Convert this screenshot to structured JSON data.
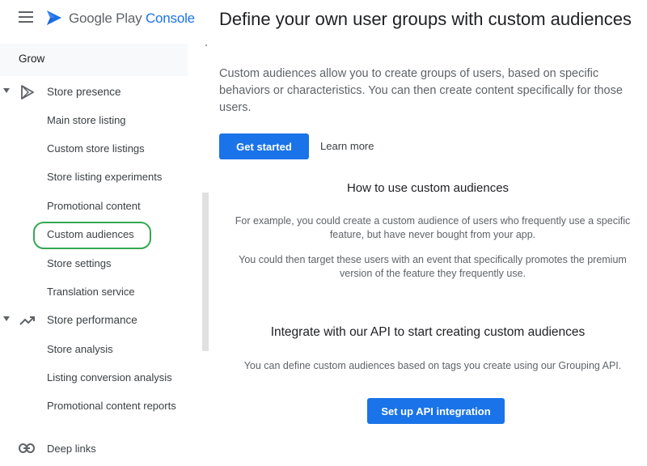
{
  "header": {
    "logo_text_main": "Google Play",
    "logo_text_accent": "Console",
    "brand_color": "#1a73e8"
  },
  "sidebar": {
    "group_label": "Grow",
    "sections": [
      {
        "label": "Store presence",
        "icon": "play-triangle-icon",
        "items": [
          "Main store listing",
          "Custom store listings",
          "Store listing experiments",
          "Promotional content",
          "Custom audiences",
          "Store settings",
          "Translation service"
        ]
      },
      {
        "label": "Store performance",
        "icon": "trending-up-icon",
        "items": [
          "Store analysis",
          "Listing conversion analysis",
          "Promotional content reports"
        ]
      }
    ],
    "deep_links_label": "Deep links",
    "highlighted_item": "Custom audiences",
    "highlight_color": "#34a853"
  },
  "main": {
    "title": "Define your own user groups with custom audiences",
    "intro": "Custom audiences allow you to create groups of users, based on specific behaviors or characteristics. You can then create content specifically for those users.",
    "get_started_label": "Get started",
    "learn_more_label": "Learn more",
    "how_to_title": "How to use custom audiences",
    "how_to_p1": "For example, you could create a custom audience of users who frequently use a specific feature, but have never bought from your app.",
    "how_to_p2": "You could then target these users with an event that specifically promotes the premium version of the feature they frequently use.",
    "integrate_title": "Integrate with our API to start creating custom audiences",
    "integrate_p": "You can define custom audiences based on tags you create using our Grouping API.",
    "api_button_label": "Set up API integration"
  }
}
